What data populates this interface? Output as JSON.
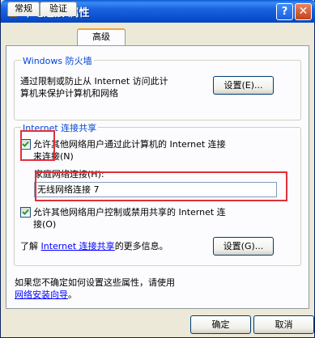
{
  "window": {
    "title": "本地连接 属性",
    "help_label": "?",
    "close_label": "✕"
  },
  "tabs": [
    {
      "label": "常规"
    },
    {
      "label": "验证"
    },
    {
      "label": "高级"
    }
  ],
  "firewall": {
    "legend": "Windows 防火墙",
    "desc_line1": "通过限制或防止从 Internet 访问此计",
    "desc_line2": "算机来保护计算机和网络",
    "settings_label": "设置(E)..."
  },
  "ics": {
    "legend": "Internet 连接共享",
    "allow_connect_line1": "允许其他网络用户通过此计算机的 Internet 连接",
    "allow_connect_line2": "来连接(N)",
    "allow_connect_checked": true,
    "home_network_label": "家庭网络连接(H):",
    "home_network_value": "无线网络连接 7",
    "allow_control_line1": "允许其他网络用户控制或禁用共享的 Internet 连",
    "allow_control_line2": "接(O)",
    "allow_control_checked": true,
    "learn_prefix": "了解",
    "learn_link": "Internet 连接共享",
    "learn_suffix": "的更多信息。",
    "settings_label": "设置(G)..."
  },
  "footer": {
    "line1": "如果您不确定如何设置这些属性，请使用",
    "wizard_link": "网络安装向导",
    "line2_suffix": "。"
  },
  "buttons": {
    "ok": "确定",
    "cancel": "取消"
  }
}
